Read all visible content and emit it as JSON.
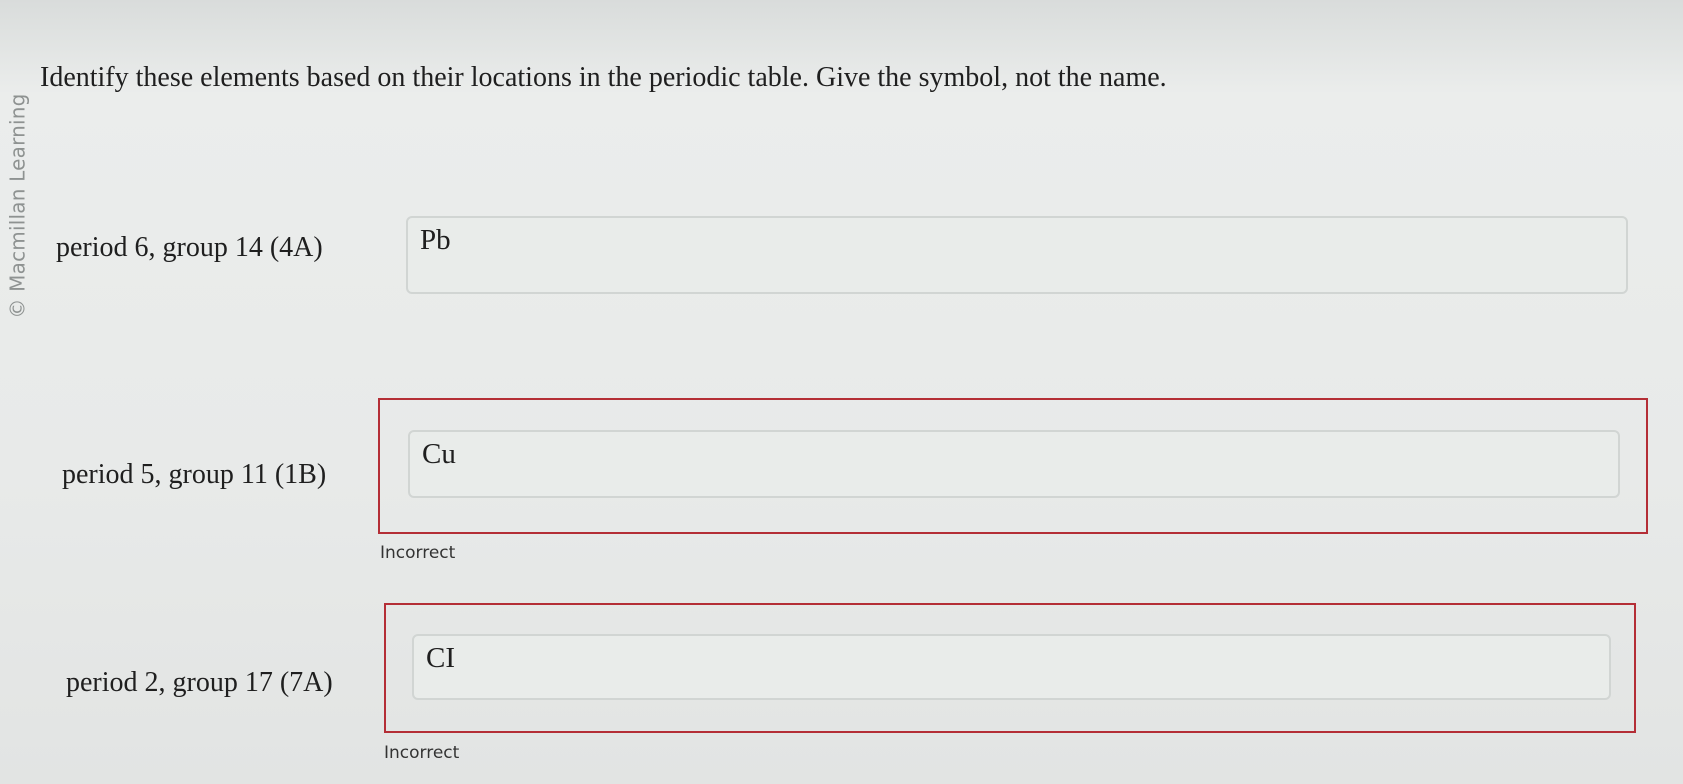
{
  "watermark": "© Macmillan Learning",
  "instruction": "Identify these elements based on their locations in the periodic table. Give the symbol, not the name.",
  "questions": [
    {
      "label": "period 6, group 14 (4A)",
      "answer": "Pb",
      "feedback": ""
    },
    {
      "label": "period 5, group 11 (1B)",
      "answer": "Cu",
      "feedback": "Incorrect"
    },
    {
      "label": "period 2, group 17 (7A)",
      "answer": "CI",
      "feedback": "Incorrect"
    }
  ],
  "colors": {
    "error_border": "#b42e36",
    "input_background": "#e9ecea"
  }
}
